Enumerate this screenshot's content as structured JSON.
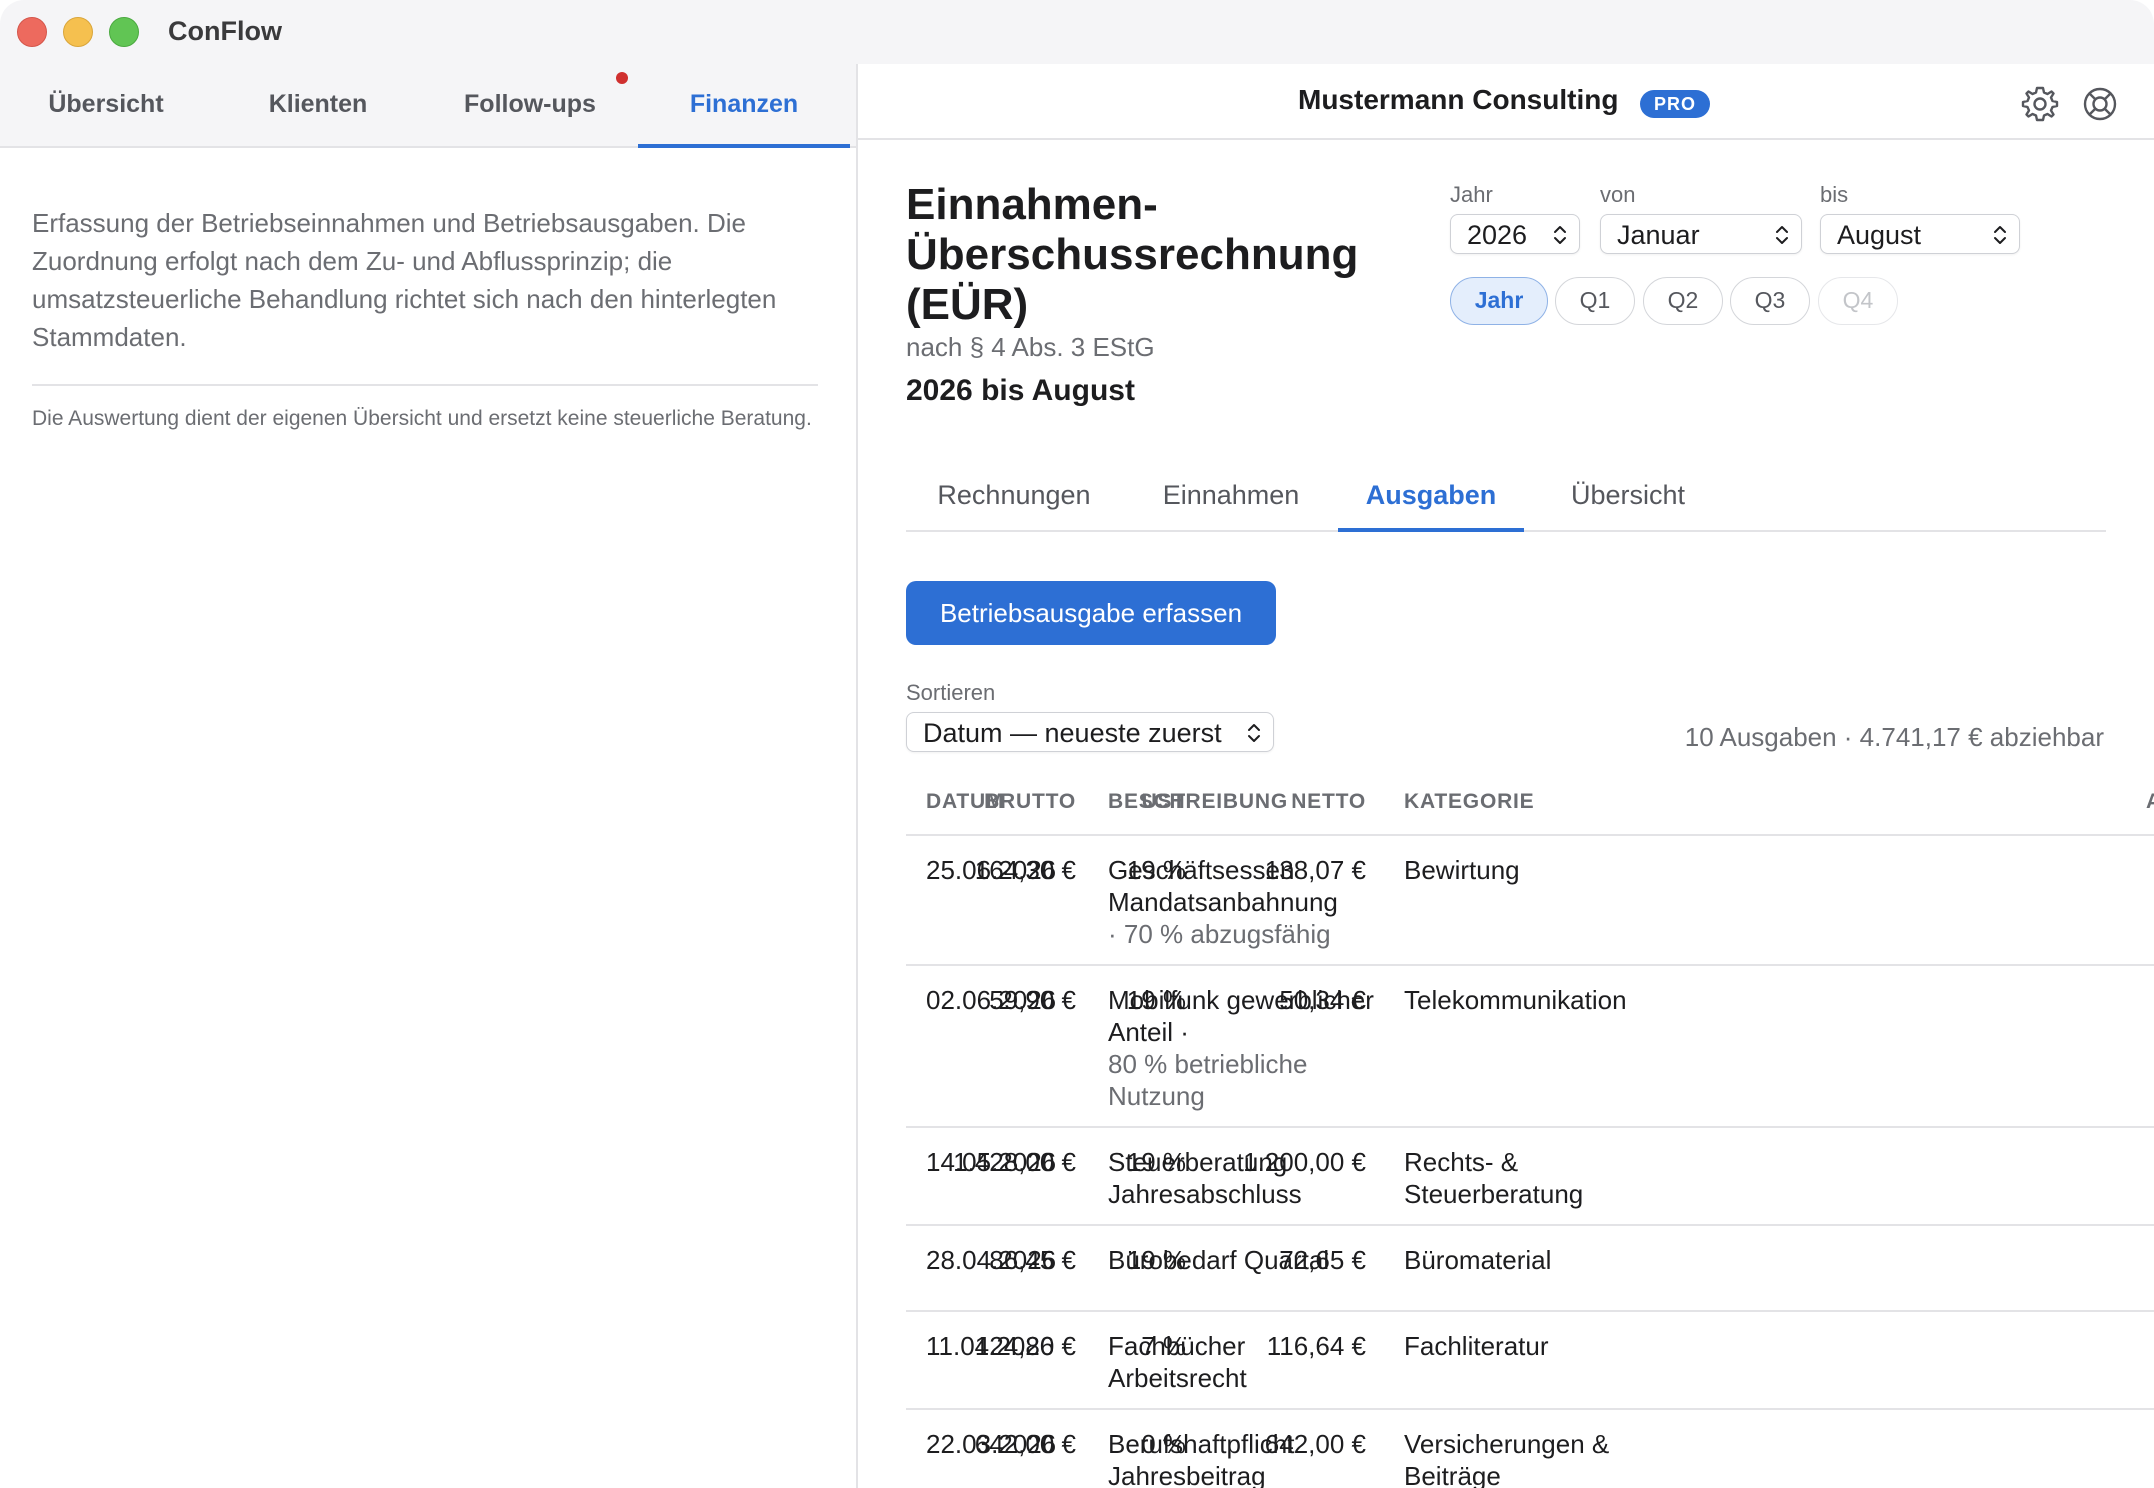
{
  "app": {
    "title": "ConFlow"
  },
  "left": {
    "tabs": [
      {
        "label": "Übersicht"
      },
      {
        "label": "Klienten"
      },
      {
        "label": "Follow-ups"
      },
      {
        "label": "Finanzen"
      }
    ],
    "description": "Erfassung der Betriebseinnahmen und Betriebsausgaben. Die Zuordnung erfolgt nach dem Zu- und Abflussprinzip; die umsatzsteuerliche Behandlung richtet sich nach den hinterlegten Stammdaten.",
    "note": "Die Auswertung dient der eigenen Übersicht und ersetzt keine steuerliche Beratung."
  },
  "header": {
    "company": "Mustermann Consulting",
    "badge": "PRO",
    "icons": [
      "gear-icon",
      "help-lifebuoy-icon"
    ]
  },
  "report": {
    "title_line1": "Einnahmen-",
    "title_line2": "Überschussrechnung",
    "title_line3": "(EÜR)",
    "subtitle": "nach § 4 Abs. 3 EStG",
    "range": "2026 bis August"
  },
  "filters": {
    "year_label": "Jahr",
    "year_value": "2026",
    "from_label": "von",
    "from_value": "Januar",
    "to_label": "bis",
    "to_value": "August",
    "periods": [
      "Jahr",
      "Q1",
      "Q2",
      "Q3",
      "Q4"
    ],
    "active_period": "Jahr"
  },
  "subtabs": [
    {
      "label": "Rechnungen"
    },
    {
      "label": "Einnahmen"
    },
    {
      "label": "Ausgaben"
    },
    {
      "label": "Übersicht"
    }
  ],
  "actions": {
    "add_expense": "Betriebsausgabe erfassen"
  },
  "sort": {
    "label": "Sortieren",
    "value": "Datum — neueste zuerst"
  },
  "summary": "10 Ausgaben · 4.741,17 € abziehbar",
  "table": {
    "columns": [
      "DATUM",
      "BESCHREIBUNG",
      "KATEGORIE",
      "BRUTTO",
      "UST",
      "NETTO",
      "A"
    ],
    "rows": [
      {
        "date": "25.06.2026",
        "desc": "Geschäftsessen Mandatsanbahnung",
        "desc_note": "· 70 % abzugsfähig",
        "category": "Bewirtung",
        "gross": "164,30 €",
        "vat": "19 %",
        "net": "138,07 €"
      },
      {
        "date": "02.06.2026",
        "desc": "Mobilfunk gewerblicher Anteil ·",
        "desc_note": "80 % betriebliche Nutzung",
        "category": "Telekommunikation",
        "gross": "59,90 €",
        "vat": "19 %",
        "net": "50,34 €"
      },
      {
        "date": "14.05.2026",
        "desc": "Steuerberatung Jahresabschluss",
        "desc_note": "",
        "category": "Rechts- & Steuerberatung",
        "gross": "1.428,00 €",
        "vat": "19 %",
        "net": "1.200,00 €"
      },
      {
        "date": "28.04.2026",
        "desc": "Bürobedarf Quartal",
        "desc_note": "",
        "category": "Büromaterial",
        "gross": "86,45 €",
        "vat": "19 %",
        "net": "72,65 €"
      },
      {
        "date": "11.04.2026",
        "desc": "Fachbücher Arbeitsrecht",
        "desc_note": "",
        "category": "Fachliteratur",
        "gross": "124,80 €",
        "vat": "7 %",
        "net": "116,64 €"
      },
      {
        "date": "22.03.2026",
        "desc": "Berufshaftpflicht Jahresbeitrag",
        "desc_note": "",
        "category": "Versicherungen & Beiträge",
        "gross": "642,00 €",
        "vat": "0 %",
        "net": "642,00 €"
      }
    ]
  }
}
